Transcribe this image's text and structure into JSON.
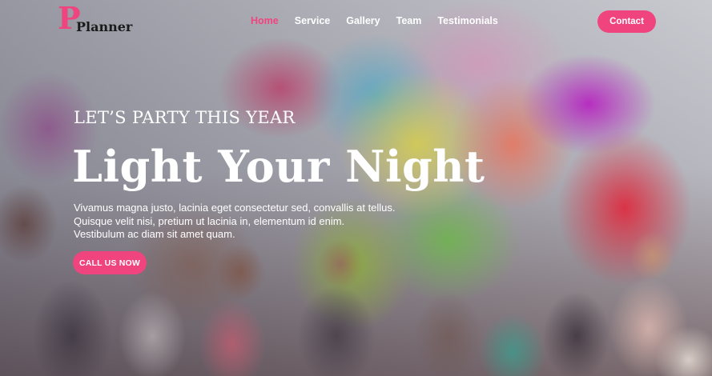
{
  "brand": {
    "logo_letter": "P",
    "logo_word": "Planner",
    "accent": "#f0447f"
  },
  "nav": {
    "items": [
      {
        "label": "Home",
        "active": true
      },
      {
        "label": "Service",
        "active": false
      },
      {
        "label": "Gallery",
        "active": false
      },
      {
        "label": "Team",
        "active": false
      },
      {
        "label": "Testimonials",
        "active": false
      }
    ],
    "contact_label": "Contact"
  },
  "hero": {
    "tagline": "LET’S PARTY THIS YEAR",
    "headline": "Light Your Night",
    "description_lines": [
      "Vivamus magna justo, lacinia eget consectetur sed, convallis at tellus.",
      "Quisque velit nisi, pretium ut lacinia in, elementum id enim.",
      "Vestibulum ac diam sit amet quam."
    ],
    "cta_label": "CALL US NOW"
  }
}
